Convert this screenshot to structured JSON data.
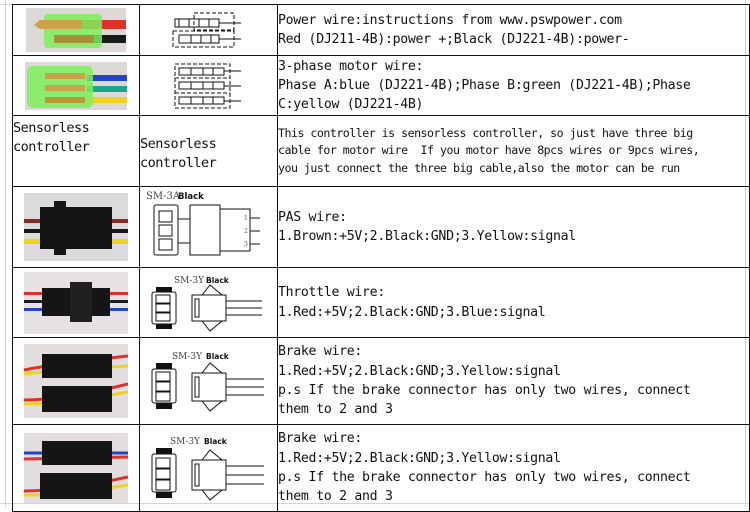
{
  "document": {
    "type": "wiring-instructions-table",
    "rows": [
      {
        "photo": "power-connector-photo",
        "diagram": "bullet-connector-pair-diagram",
        "description": [
          "Power wire:instructions from www.pswpower.com",
          "Red (DJ211-4B):power +;Black (DJ221-4B):power-"
        ]
      },
      {
        "photo": "motor-phase-connector-photo",
        "diagram": "bullet-connector-triple-diagram",
        "description": [
          "3-phase motor wire:",
          "Phase A:blue (DJ221-4B);Phase B:green (DJ221-4B);Phase",
          "C:yellow (DJ221-4B)"
        ]
      },
      {
        "label_col1": "Sensorless controller",
        "label_col2": "Sensorless controller",
        "description": [
          "This controller is sensorless controller, so just have three big",
          "cable for motor wire  If you motor have 8pcs wires or 9pcs wires,",
          "you just connect the three big cable,also the motor can be run"
        ]
      },
      {
        "photo": "pas-connector-photo",
        "diagram_model": "SM-3A",
        "diagram_color": "Black",
        "pin_numbers": [
          "1",
          "2",
          "3"
        ],
        "description": [
          "PAS wire:",
          "1.Brown:+5V;2.Black:GND;3.Yellow:signal"
        ]
      },
      {
        "photo": "throttle-connector-photo",
        "diagram_model": "SM-3Y",
        "diagram_color": "Black",
        "description": [
          "Throttle wire:",
          "1.Red:+5V;2.Black:GND;3.Blue:signal"
        ]
      },
      {
        "photo": "brake-connector-photo",
        "diagram_model": "SM-3Y",
        "diagram_color": "Black",
        "description": [
          "Brake wire:",
          "1.Red:+5V;2.Black:GND;3.Yellow:signal",
          "p.s If the brake connector has only two wires, connect",
          "them to 2 and 3"
        ]
      },
      {
        "photo": "brake-connector-photo-2",
        "diagram_model": "SM-3Y",
        "diagram_color": "Black",
        "description": [
          "Brake wire:",
          "1.Red:+5V;2.Black:GND;3.Yellow:signal",
          "p.s If the brake connector has only two wires, connect",
          "them to 2 and 3"
        ]
      }
    ]
  },
  "colors": {
    "wire_red": "#e0302a",
    "wire_black": "#1a1a1a",
    "wire_blue": "#2244c8",
    "wire_green": "#1aa88a",
    "wire_yellow": "#f0d21c",
    "wire_brown": "#8a2a1a",
    "sleeve_green": "#7cf05a",
    "connector_black": "#151515"
  }
}
